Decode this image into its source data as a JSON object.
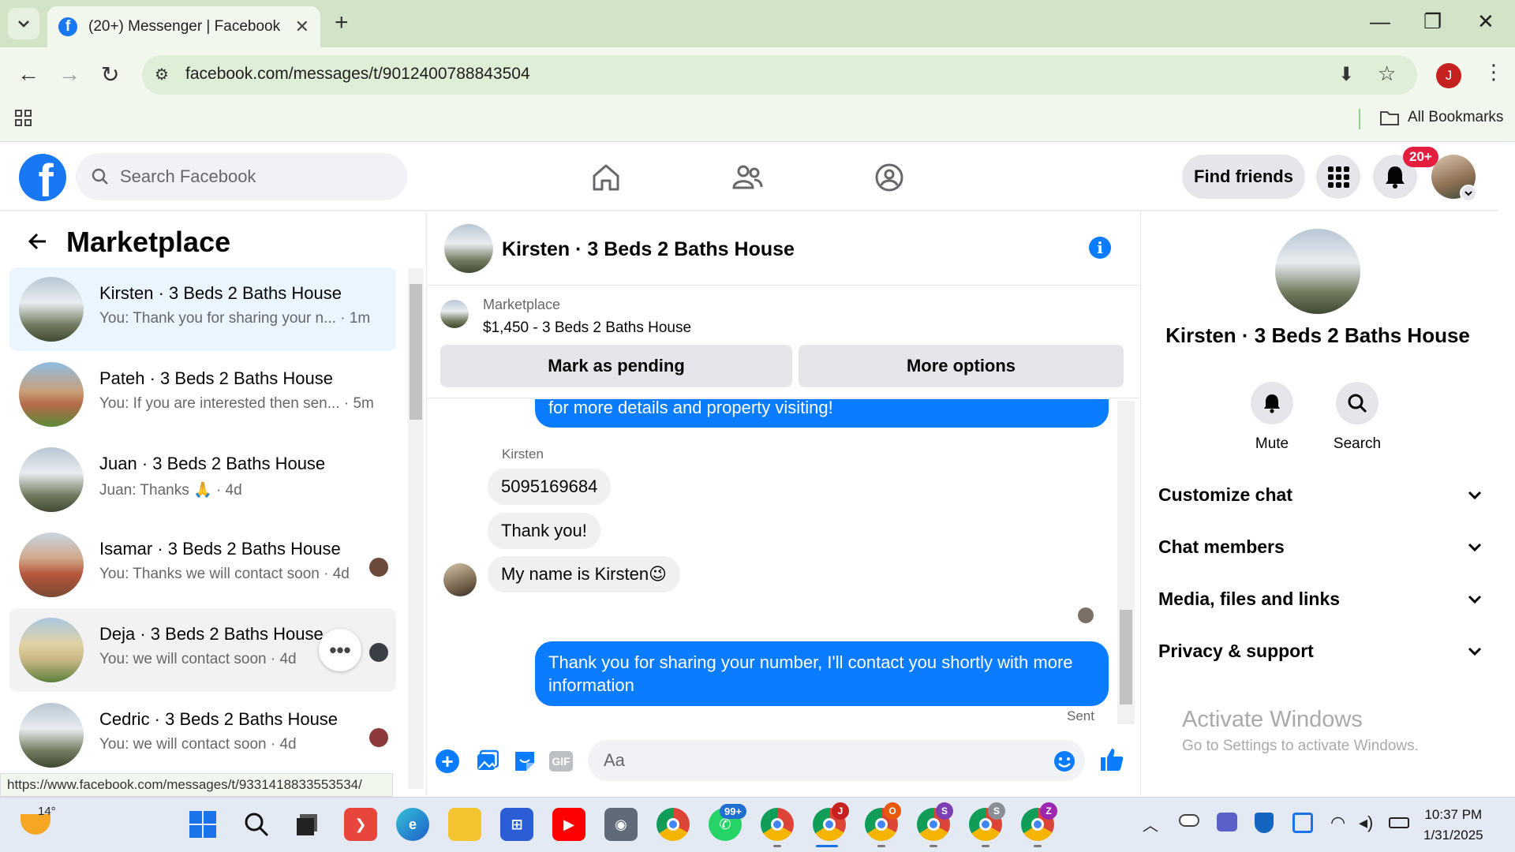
{
  "browser": {
    "tab_title": "(20+) Messenger | Facebook",
    "url": "facebook.com/messages/t/9012400788843504",
    "bookmarks_label": "All Bookmarks",
    "profile_initial": "J",
    "status_url": "https://www.facebook.com/messages/t/9331418833553534/"
  },
  "fb": {
    "search_placeholder": "Search Facebook",
    "find_friends": "Find friends",
    "notif_badge": "20+",
    "brand_color": "#1877f2"
  },
  "left": {
    "title": "Marketplace",
    "conversations": [
      {
        "name": "Kirsten · 3 Beds 2 Baths House",
        "preview": "You: Thank you for sharing your n...",
        "time": "· 1m"
      },
      {
        "name": "Pateh · 3 Beds 2 Baths House",
        "preview": "You: If you are interested then sen...",
        "time": "· 5m"
      },
      {
        "name": "Juan · 3 Beds 2 Baths House",
        "preview": "Juan: Thanks 🙏",
        "time": "· 4d"
      },
      {
        "name": "Isamar · 3 Beds 2 Baths House",
        "preview": "You: Thanks we will contact soon",
        "time": "· 4d"
      },
      {
        "name": "Deja · 3 Beds 2 Baths House",
        "preview": "You: we will contact soon",
        "time": "· 4d"
      },
      {
        "name": "Cedric · 3 Beds 2 Baths House",
        "preview": "You: we will contact soon",
        "time": "· 4d"
      }
    ]
  },
  "chat": {
    "title": "Kirsten · 3 Beds 2 Baths House",
    "banner_label": "Marketplace",
    "banner_listing": "$1,450 - 3 Beds 2 Baths House",
    "mark_pending": "Mark as pending",
    "more_options": "More options",
    "messages": {
      "partial_out": "for more details and property visiting!",
      "sender": "Kirsten",
      "in1": "5095169684",
      "in2": "Thank you!",
      "in3": "My name is Kirsten😉",
      "out_last": "Thank you for sharing your number, I'll contact you shortly with more information",
      "status": "Sent"
    },
    "composer_placeholder": "Aa",
    "gif_label": "GIF"
  },
  "info": {
    "name": "Kirsten · 3 Beds 2 Baths House",
    "mute": "Mute",
    "search": "Search",
    "sections": [
      "Customize chat",
      "Chat members",
      "Media, files and links",
      "Privacy & support"
    ]
  },
  "watermark": {
    "line1": "Activate Windows",
    "line2": "Go to Settings to activate Windows."
  },
  "taskbar": {
    "weather": "14°",
    "whatsapp_badge": "99+",
    "time": "10:37 PM",
    "date": "1/31/2025",
    "chrome_profiles": [
      "J",
      "O",
      "S",
      "S",
      "Z"
    ]
  }
}
